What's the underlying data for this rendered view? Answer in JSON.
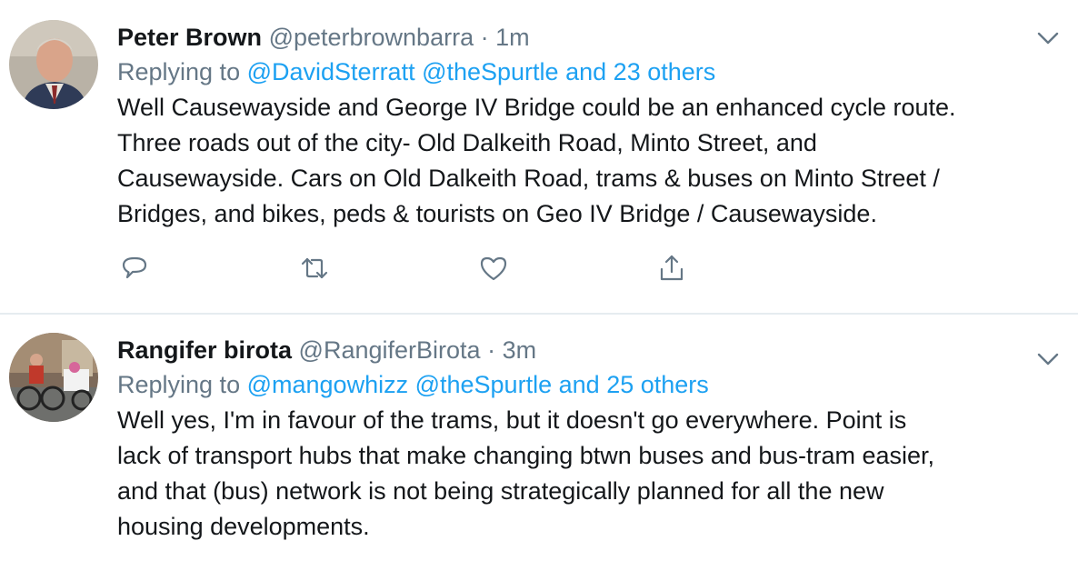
{
  "tweets": [
    {
      "author_name": "Peter Brown",
      "handle": "@peterbrownbarra",
      "separator": "·",
      "time": "1m",
      "replying_prefix": "Replying to",
      "replying_users": "@DavidSterratt @theSpurtle",
      "replying_conjunction": "and",
      "replying_others": "23 others",
      "body_lines": [
        "Well Causewayside and George IV Bridge could be an enhanced cycle route.",
        "Three roads out of the city- Old Dalkeith Road, Minto Street, and",
        "Causewayside. Cars on Old Dalkeith Road, trams & buses on Minto Street /",
        "Bridges, and bikes, peds & tourists on Geo IV Bridge / Causewayside."
      ],
      "actions": [
        "reply-icon",
        "retweet-icon",
        "like-icon",
        "share-icon"
      ]
    },
    {
      "author_name": "Rangifer birota",
      "handle": "@RangiferBirota",
      "separator": "·",
      "time": "3m",
      "replying_prefix": "Replying to",
      "replying_users": "@mangowhizz @theSpurtle",
      "replying_conjunction": "and",
      "replying_others": "25 others",
      "body_lines": [
        "Well yes, I'm in favour of the trams, but it doesn't go everywhere. Point is",
        "lack of transport hubs that make changing btwn buses and bus-tram easier,",
        "and that (bus) network is not being strategically planned for all the new",
        "housing developments."
      ]
    }
  ],
  "colors": {
    "text": "#14171a",
    "secondary": "#657786",
    "link": "#1da1f2",
    "divider": "#e6ecf0"
  }
}
